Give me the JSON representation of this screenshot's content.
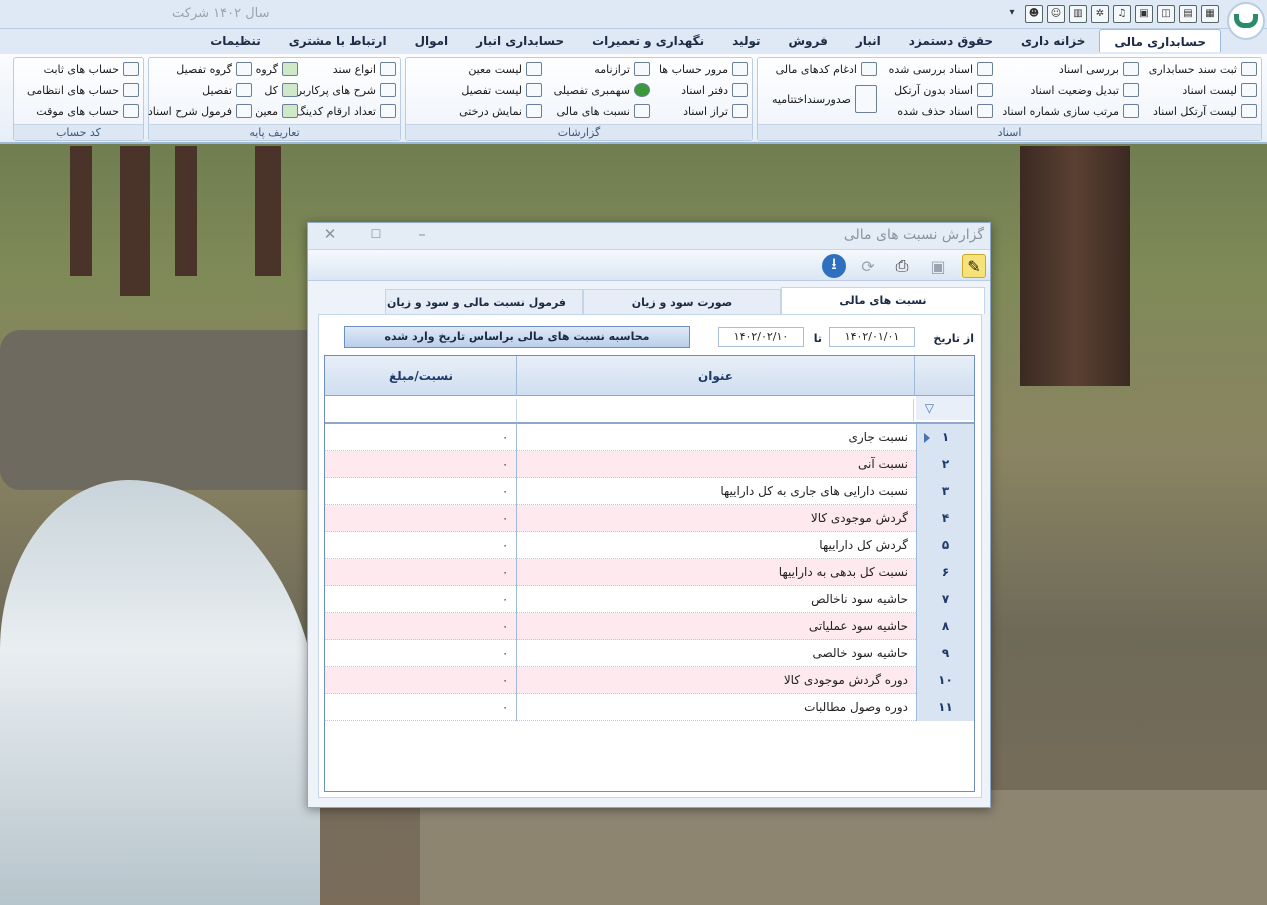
{
  "app": {
    "year_company": "سال ۱۴۰۲ شرکت"
  },
  "tabs": [
    "حسابداری مالی",
    "خزانه داری",
    "حقوق دستمزد",
    "انبار",
    "فروش",
    "تولید",
    "نگهداری و تعمیرات",
    "حسابداری انبار",
    "اموال",
    "ارتباط با مشتری",
    "تنظیمات"
  ],
  "ribbon": {
    "asnad": {
      "label": "اسناد",
      "col1": [
        "ثبت سند حسابداری",
        "لیست اسناد",
        "لیست آرتکل اسناد"
      ],
      "col2": [
        "بررسی اسناد",
        "تبدیل وضعیت اسناد",
        "مرتب سازی شماره اسناد"
      ],
      "col3": [
        "اسناد بررسی شده",
        "اسناد بدون آرتکل",
        "اسناد حذف شده"
      ],
      "col4": [
        "ادغام کدهای مالی",
        "صدورسنداختتامیه"
      ]
    },
    "reports": {
      "label": "گزارشات",
      "col1": [
        "مرور حساب ها",
        "دفتر اسناد",
        "تراز اسناد"
      ],
      "col2": [
        "ترازنامه",
        "سهمبری تفصیلی",
        "نسبت های مالی"
      ],
      "col3": [
        "لیست معین",
        "لیست تفصیل",
        "نمایش درختی"
      ]
    },
    "base": {
      "label": "تعاریف پایه",
      "col1": [
        "انواع سند",
        "شرح های پرکاربرد",
        "تعداد ارقام کدینگ"
      ],
      "col2": [
        "گروه",
        "کل",
        "معین"
      ],
      "col3": [
        "گروه تفصیل",
        "تفصیل",
        "فرمول شرح اسناد"
      ]
    },
    "accounts": {
      "label": "کد حساب",
      "col1": [
        "حساب های ثابت",
        "حساب های انتظامی",
        "حساب های موقت"
      ]
    }
  },
  "dialog": {
    "title": "گزارش نسبت های مالی",
    "tabs": [
      "نسبت های مالی",
      "صورت سود و زیان",
      "فرمول نسبت مالی و سود و زیان"
    ],
    "from_label": "از تاریخ",
    "from_date": "۱۴۰۲/۰۱/۰۱",
    "to_label": "تا",
    "to_date": "۱۴۰۲/۰۲/۱۰",
    "calc_button": "محاسبه نسبت های مالی براساس تاریخ وارد شده",
    "columns": {
      "title": "عنوان",
      "value": "نسبت/مبلغ"
    },
    "rows": [
      {
        "num": "۱",
        "title": "نسبت جاری",
        "value": "۰"
      },
      {
        "num": "۲",
        "title": "نسبت آنی",
        "value": "۰"
      },
      {
        "num": "۳",
        "title": "نسبت دارایی های جاری به کل داراییها",
        "value": "۰"
      },
      {
        "num": "۴",
        "title": "گردش موجودی کالا",
        "value": "۰"
      },
      {
        "num": "۵",
        "title": "گردش کل داراییها",
        "value": "۰"
      },
      {
        "num": "۶",
        "title": "نسبت کل بدهی به داراییها",
        "value": "۰"
      },
      {
        "num": "۷",
        "title": "حاشیه سود ناخالص",
        "value": "۰"
      },
      {
        "num": "۸",
        "title": "حاشیه سود عملیاتی",
        "value": "۰"
      },
      {
        "num": "۹",
        "title": "حاشیه سود خالصی",
        "value": "۰"
      },
      {
        "num": "۱۰",
        "title": "دوره گردش موجودی کالا",
        "value": "۰"
      },
      {
        "num": "۱۱",
        "title": "دوره وصول مطالبات",
        "value": "۰"
      }
    ]
  }
}
